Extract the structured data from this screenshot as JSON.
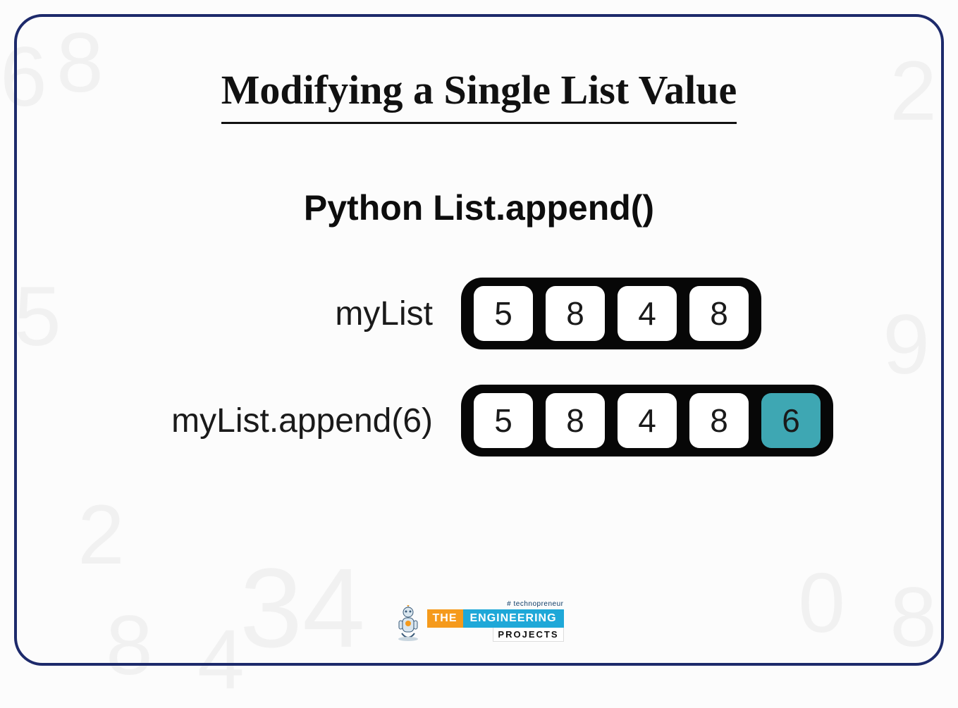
{
  "title": "Modifying a Single List Value",
  "subtitle": "Python List.append()",
  "rows": [
    {
      "label": "myList",
      "cells": [
        {
          "v": "5",
          "hl": false
        },
        {
          "v": "8",
          "hl": false
        },
        {
          "v": "4",
          "hl": false
        },
        {
          "v": "8",
          "hl": false
        }
      ]
    },
    {
      "label": "myList.append(6)",
      "cells": [
        {
          "v": "5",
          "hl": false
        },
        {
          "v": "8",
          "hl": false
        },
        {
          "v": "4",
          "hl": false
        },
        {
          "v": "8",
          "hl": false
        },
        {
          "v": "6",
          "hl": true
        }
      ]
    }
  ],
  "footer": {
    "tagline": "# technopreneur",
    "the": "THE",
    "eng": "ENGINEERING",
    "proj": "PROJECTS"
  },
  "colors": {
    "frame": "#1d2a6b",
    "highlight": "#3ea7b3",
    "bar_orange": "#f59a1c",
    "bar_blue": "#1fa8d8"
  }
}
